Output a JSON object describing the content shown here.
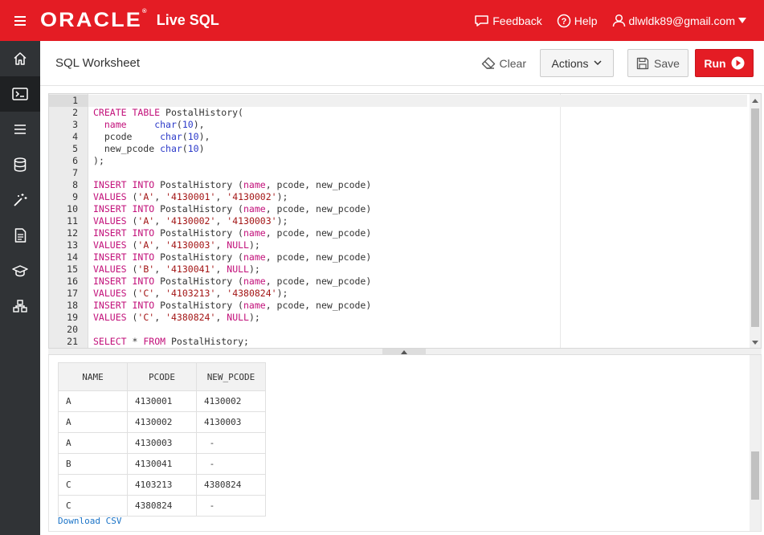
{
  "topbar": {
    "brand": "ORACLE",
    "product": "Live SQL",
    "feedback": "Feedback",
    "help": "Help",
    "user": "dlwldk89@gmail.com"
  },
  "sidebar": {
    "items": [
      {
        "icon": "home-icon"
      },
      {
        "icon": "terminal-icon",
        "active": true
      },
      {
        "icon": "list-icon"
      },
      {
        "icon": "database-icon"
      },
      {
        "icon": "magic-wand-icon"
      },
      {
        "icon": "document-icon"
      },
      {
        "icon": "graduation-cap-icon"
      },
      {
        "icon": "hierarchy-icon"
      }
    ]
  },
  "header": {
    "title": "SQL Worksheet",
    "clear": "Clear",
    "actions": "Actions",
    "save": "Save",
    "run": "Run"
  },
  "editor": {
    "lines": [
      "",
      "CREATE TABLE PostalHistory(",
      "  name     char(10),",
      "  pcode     char(10),",
      "  new_pcode char(10)",
      ");",
      "",
      "INSERT INTO PostalHistory (name, pcode, new_pcode)",
      "VALUES ('A', '4130001', '4130002');",
      "INSERT INTO PostalHistory (name, pcode, new_pcode)",
      "VALUES ('A', '4130002', '4130003');",
      "INSERT INTO PostalHistory (name, pcode, new_pcode)",
      "VALUES ('A', '4130003', NULL);",
      "INSERT INTO PostalHistory (name, pcode, new_pcode)",
      "VALUES ('B', '4130041', NULL);",
      "INSERT INTO PostalHistory (name, pcode, new_pcode)",
      "VALUES ('C', '4103213', '4380824');",
      "INSERT INTO PostalHistory (name, pcode, new_pcode)",
      "VALUES ('C', '4380824', NULL);",
      "",
      "SELECT * FROM PostalHistory;"
    ]
  },
  "results": {
    "columns": [
      "NAME",
      "PCODE",
      "NEW_PCODE"
    ],
    "rows": [
      [
        "A",
        "4130001",
        "4130002"
      ],
      [
        "A",
        "4130002",
        "4130003"
      ],
      [
        "A",
        "4130003",
        " -"
      ],
      [
        "B",
        "4130041",
        " -"
      ],
      [
        "C",
        "4103213",
        "4380824"
      ],
      [
        "C",
        "4380824",
        " -"
      ]
    ],
    "download": "Download CSV"
  },
  "colors": {
    "brand_red": "#e41c24",
    "sidebar": "#303336",
    "keyword": "#c2107a",
    "function": "#2c3ac9",
    "string": "#a31515"
  }
}
